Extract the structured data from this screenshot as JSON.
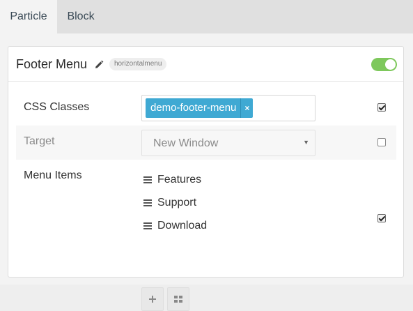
{
  "tabs": [
    {
      "label": "Particle",
      "active": true
    },
    {
      "label": "Block",
      "active": false
    }
  ],
  "card": {
    "title": "Footer Menu",
    "type_badge": "horizontalmenu",
    "enabled": true,
    "accent_color": "#7ec85c"
  },
  "fields": {
    "css_classes": {
      "label": "CSS Classes",
      "tags": [
        "demo-footer-menu"
      ],
      "tag_remove": "×",
      "tag_color": "#3fa9d3",
      "override_checked": true
    },
    "target": {
      "label": "Target",
      "value": "New Window",
      "override_checked": false
    },
    "menu_items": {
      "label": "Menu Items",
      "items": [
        "Features",
        "Support",
        "Download"
      ],
      "override_checked": true,
      "add_icon": "plus-icon",
      "grid_icon": "grid-icon"
    }
  }
}
